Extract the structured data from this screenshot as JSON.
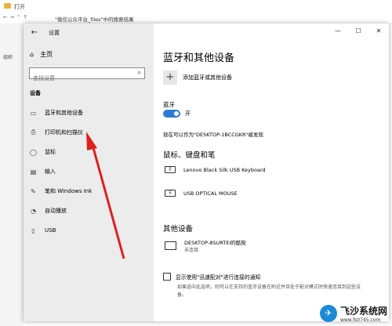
{
  "background_window": {
    "title": "打开",
    "path": "\"微信公众平台_files\"中的搜索结果",
    "column_label": "组织"
  },
  "settings": {
    "title": "设置",
    "controls": [
      "—",
      "☐",
      "✕"
    ],
    "home": "主页",
    "search_placeholder": "查找设置",
    "section": "设备",
    "nav": [
      {
        "label": "蓝牙和其他设备",
        "icon": "bluetooth-devices-icon"
      },
      {
        "label": "打印机和扫描仪",
        "icon": "printer-icon"
      },
      {
        "label": "鼠标",
        "icon": "mouse-icon"
      },
      {
        "label": "输入",
        "icon": "keyboard-icon"
      },
      {
        "label": "笔和 Windows Ink",
        "icon": "pen-icon"
      },
      {
        "label": "自动播放",
        "icon": "autoplay-icon"
      },
      {
        "label": "USB",
        "icon": "usb-icon"
      }
    ]
  },
  "main": {
    "title": "蓝牙和其他设备",
    "add_device": "添加蓝牙或其他设备",
    "bluetooth_label": "蓝牙",
    "bluetooth_state": "开",
    "discoverable": "现在可以作为\"DESKTOP-1BCCGKR\"被发现",
    "mouse_kb_header": "鼠标、键盘和笔",
    "devices": [
      "Lenovo Black Silk USB Keyboard",
      "USB OPTICAL MOUSE"
    ],
    "other_header": "其他设备",
    "other_device_name": "DESKTOP-8SURTEI的酷狗",
    "other_device_status": "未连接",
    "swift_pair_label": "显示使用\"迅速配对\"进行连接的通知",
    "help_text": "如果选中此选项，则可以在支持的蓝牙设备在附近并且处于配对模式时快速连接到这些设备。"
  },
  "watermark": {
    "name": "飞沙系统网",
    "url": "www.fs0745.com"
  },
  "colors": {
    "accent": "#2a7bd6",
    "arrow": "#e0201c"
  }
}
